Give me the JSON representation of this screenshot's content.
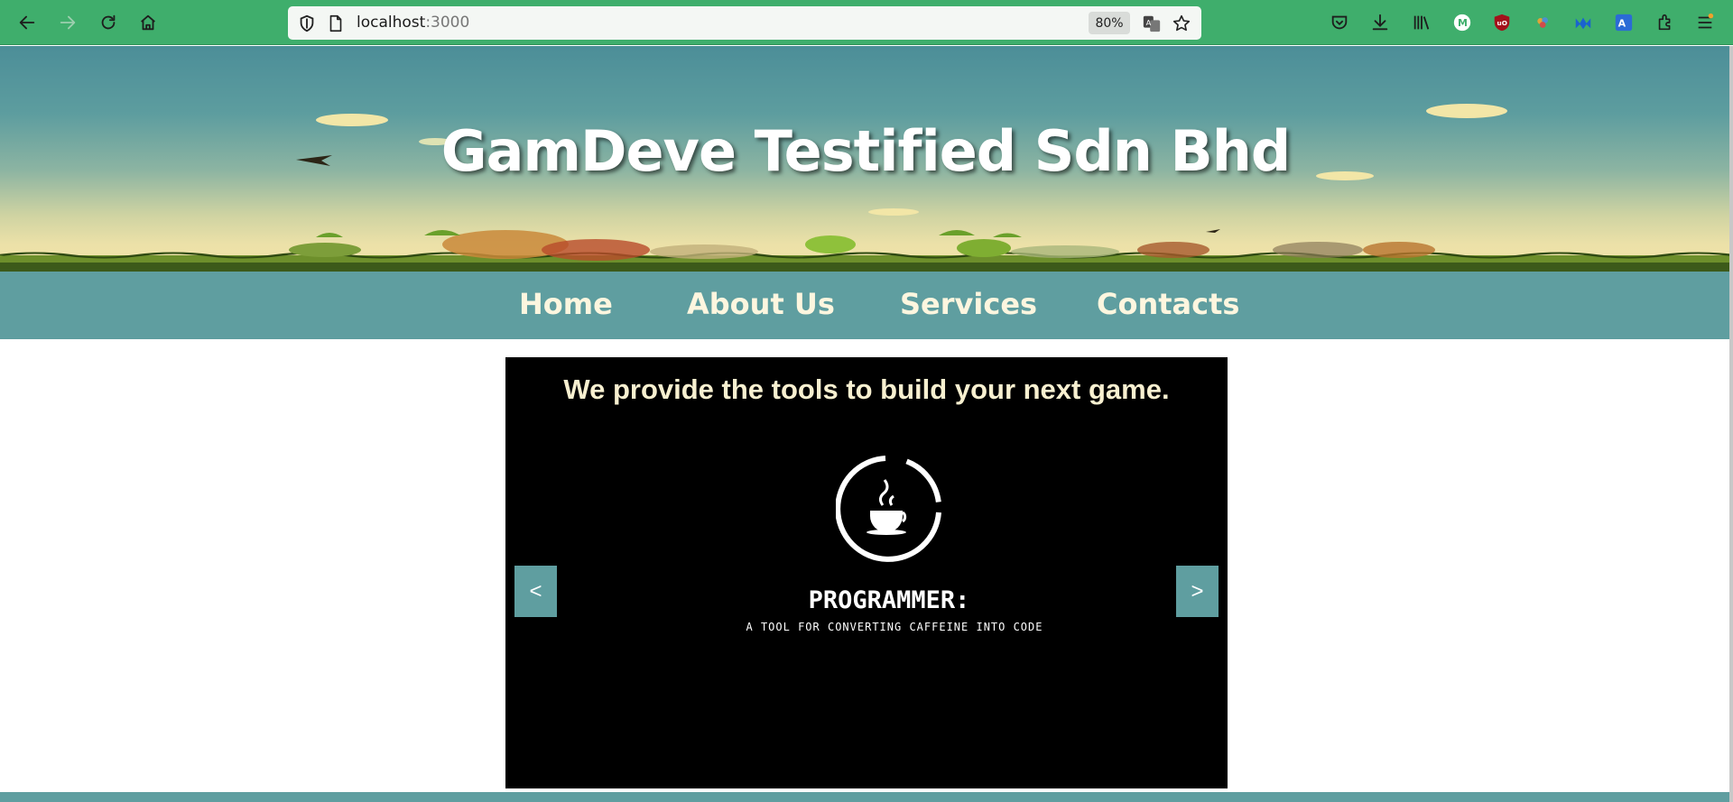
{
  "browser": {
    "url_host": "localhost",
    "url_port": ":3000",
    "zoom": "80%",
    "icons": {
      "back": "back-arrow-icon",
      "forward": "forward-arrow-icon",
      "reload": "reload-icon",
      "home": "home-icon",
      "shield": "tracking-shield-icon",
      "page": "page-icon",
      "translate": "translate-icon",
      "bookmark": "bookmark-star-icon",
      "pocket": "pocket-icon",
      "downloads": "download-icon",
      "library": "library-icon",
      "menu": "hamburger-menu-icon"
    },
    "extensions": [
      "M",
      "uO"
    ]
  },
  "site": {
    "title": "GamDeve Testified Sdn Bhd",
    "nav": [
      {
        "label": "Home"
      },
      {
        "label": "About Us"
      },
      {
        "label": "Services"
      },
      {
        "label": "Contacts"
      }
    ]
  },
  "slideshow": {
    "caption": "We provide the tools to build your next game.",
    "heading": "PROGRAMMER:",
    "subheading": "A TOOL FOR CONVERTING CAFFEINE INTO CODE",
    "prev_label": "<",
    "next_label": ">",
    "logo_icon": "coffee-cup-icon"
  },
  "colors": {
    "toolbar": "#3fae6c",
    "nav": "#5f9ea0",
    "nav_text": "#fdf6df",
    "slide_bg": "#000000",
    "caption": "#f8f0d0"
  }
}
